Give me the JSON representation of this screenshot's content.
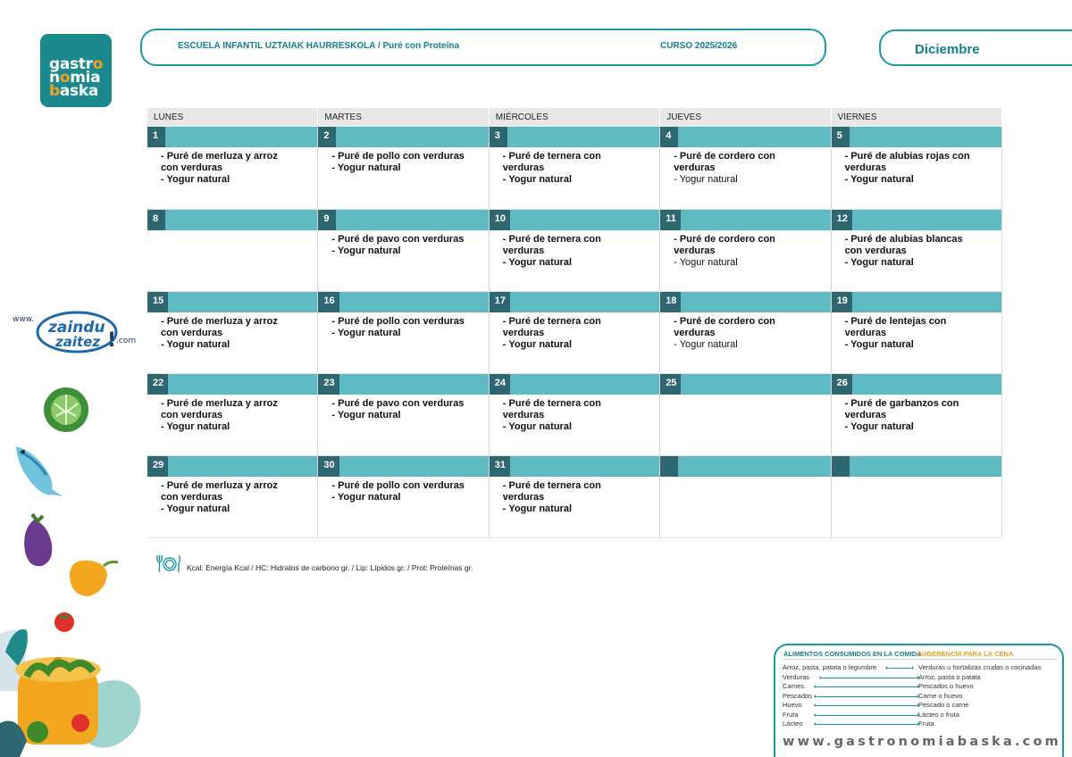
{
  "logo": {
    "line1": "gastro",
    "line2": "nomia",
    "line3": "baska"
  },
  "header": {
    "school": "ESCUELA INFANTIL UZTAIAK HAURRESKOLA / Puré con Proteína",
    "course": "CURSO 2025/2026",
    "month": "Diciembre"
  },
  "colors": {
    "accent": "#1a9aa0",
    "bar": "#5fbac4",
    "day_number_bg": "#2f6770",
    "dinner_accent": "#e9a21a"
  },
  "days": [
    "LUNES",
    "MARTES",
    "MIÉRCOLES",
    "JUEVES",
    "VIERNES"
  ],
  "weeks": [
    [
      {
        "num": "1",
        "lines": [
          {
            "t": "- Puré de merluza y arroz"
          },
          {
            "t": "con verduras"
          },
          {
            "t": "- Yogur natural"
          }
        ]
      },
      {
        "num": "2",
        "lines": [
          {
            "t": "- Puré de pollo con verduras"
          },
          {
            "t": "- Yogur natural"
          }
        ]
      },
      {
        "num": "3",
        "lines": [
          {
            "t": "- Puré de ternera con"
          },
          {
            "t": "verduras"
          },
          {
            "t": "- Yogur natural"
          }
        ]
      },
      {
        "num": "4",
        "lines": [
          {
            "t": "- Puré de cordero con"
          },
          {
            "t": "verduras"
          },
          {
            "t": "- Yogur natural",
            "plain": true
          }
        ]
      },
      {
        "num": "5",
        "lines": [
          {
            "t": "- Puré de alubias rojas con"
          },
          {
            "t": "verduras"
          },
          {
            "t": "- Yogur natural"
          }
        ]
      }
    ],
    [
      {
        "num": "8",
        "lines": []
      },
      {
        "num": "9",
        "lines": [
          {
            "t": "- Puré de pavo con verduras"
          },
          {
            "t": "- Yogur natural"
          }
        ]
      },
      {
        "num": "10",
        "lines": [
          {
            "t": "- Puré de ternera con"
          },
          {
            "t": "verduras"
          },
          {
            "t": "- Yogur natural"
          }
        ]
      },
      {
        "num": "11",
        "lines": [
          {
            "t": "- Puré de cordero con"
          },
          {
            "t": "verduras"
          },
          {
            "t": "- Yogur natural",
            "plain": true
          }
        ]
      },
      {
        "num": "12",
        "lines": [
          {
            "t": "- Puré de alubias blancas"
          },
          {
            "t": "con verduras"
          },
          {
            "t": "- Yogur natural"
          }
        ]
      }
    ],
    [
      {
        "num": "15",
        "lines": [
          {
            "t": "- Puré de merluza y arroz"
          },
          {
            "t": "con verduras"
          },
          {
            "t": "- Yogur natural"
          }
        ]
      },
      {
        "num": "16",
        "lines": [
          {
            "t": "- Puré de pollo con verduras"
          },
          {
            "t": "- Yogur natural"
          }
        ]
      },
      {
        "num": "17",
        "lines": [
          {
            "t": "- Puré de ternera con"
          },
          {
            "t": "verduras"
          },
          {
            "t": "- Yogur natural"
          }
        ]
      },
      {
        "num": "18",
        "lines": [
          {
            "t": "- Puré de cordero con"
          },
          {
            "t": "verduras"
          },
          {
            "t": "- Yogur natural",
            "plain": true
          }
        ]
      },
      {
        "num": "19",
        "lines": [
          {
            "t": "- Puré de lentejas con"
          },
          {
            "t": "verduras"
          },
          {
            "t": "- Yogur natural"
          }
        ]
      }
    ],
    [
      {
        "num": "22",
        "lines": [
          {
            "t": "- Puré de merluza y arroz"
          },
          {
            "t": "con verduras"
          },
          {
            "t": "- Yogur natural"
          }
        ]
      },
      {
        "num": "23",
        "lines": [
          {
            "t": "- Puré de pavo con verduras"
          },
          {
            "t": "- Yogur natural"
          }
        ]
      },
      {
        "num": "24",
        "lines": [
          {
            "t": "- Puré de ternera con"
          },
          {
            "t": "verduras"
          },
          {
            "t": "- Yogur natural"
          }
        ]
      },
      {
        "num": "25",
        "lines": []
      },
      {
        "num": "26",
        "lines": [
          {
            "t": "- Puré de garbanzos con"
          },
          {
            "t": "verduras"
          },
          {
            "t": "- Yogur natural"
          }
        ]
      }
    ],
    [
      {
        "num": "29",
        "lines": [
          {
            "t": "- Puré de merluza y arroz"
          },
          {
            "t": "con verduras"
          },
          {
            "t": "- Yogur natural"
          }
        ]
      },
      {
        "num": "30",
        "lines": [
          {
            "t": "- Puré de pollo con verduras"
          },
          {
            "t": "- Yogur natural"
          }
        ]
      },
      {
        "num": "31",
        "lines": [
          {
            "t": "- Puré de ternera con"
          },
          {
            "t": "verduras"
          },
          {
            "t": "- Yogur natural"
          }
        ]
      },
      {
        "num": "",
        "lines": []
      },
      {
        "num": "",
        "lines": []
      }
    ]
  ],
  "legend": "Kcal: Energía Kcal / HC: Hidratos de carbono gr. / Lip: Lípidos gr. / Prot: Proteínas gr.",
  "zaindu": {
    "prefix": "www.",
    "word1": "zaindu",
    "word2": "zaitez",
    "bang": "!",
    "suffix": ".com"
  },
  "dinner": {
    "left_title": "ALIMENTOS CONSUMIDOS EN LA COMIDA",
    "right_title": "SUGERENCIA PARA LA CENA",
    "rows": [
      {
        "left": "Arroz, pasta, patata o legumbre",
        "right": "Verduras u hortalizas crudas o cocinadas"
      },
      {
        "left": "Verduras",
        "right": "Arroz, pasta o patata"
      },
      {
        "left": "Carnes",
        "right": "Pescados o huevo"
      },
      {
        "left": "Pescados",
        "right": "Carne o huevo"
      },
      {
        "left": "Huevo",
        "right": "Pescado o carne"
      },
      {
        "left": "Fruta",
        "right": "Lácteo o fruta"
      },
      {
        "left": "Lácteo",
        "right": "Fruta"
      }
    ],
    "url": "www.gastronomiabaska.com"
  }
}
